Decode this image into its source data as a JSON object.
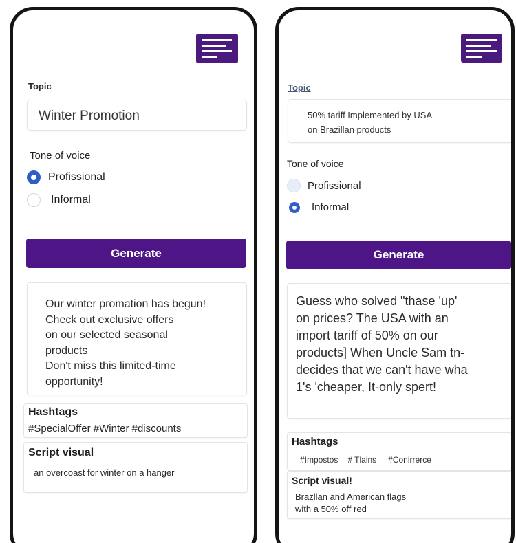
{
  "left": {
    "topic_label": "Topic",
    "topic_value": "Winter Promotion",
    "tone_label": "Tone of voice",
    "options": [
      {
        "label": "Profissional",
        "selected": true
      },
      {
        "label": "Informal",
        "selected": false
      }
    ],
    "generate_label": "Generate",
    "post_lines": [
      "Our winter promation has begun!",
      "Check out exclusive offers",
      "on our selected seasonal",
      "products",
      "Don't miss this limited-time",
      "opportunity!"
    ],
    "hashtags_title": "Hashtags",
    "hashtags": "#SpecialOffer #Winter #discounts",
    "script_title": "Script visual",
    "script_text": "an overcoast for winter on a hanger"
  },
  "right": {
    "topic_label": "Topic",
    "topic_lines": [
      "50% tariff Implemented   by USA",
      "on Brazillan products"
    ],
    "tone_label": "Tone of voice",
    "options": [
      {
        "label": "Profissional",
        "selected": false
      },
      {
        "label": "Informal",
        "selected": true
      }
    ],
    "generate_label": "Generate",
    "post_lines": [
      "Guess who solved \"thase 'up'",
      "on prices? The USA with an",
      "import tariff of 50% on our",
      "products] When Uncle Sam tn-",
      "decides that we can't have wha",
      "1's 'cheaper, It-only spert!"
    ],
    "hashtags_title": "Hashtags",
    "hashtags": [
      "#Impostos",
      "# Tlains",
      "#Conirrerce"
    ],
    "script_title": "Script visual!",
    "script_lines": [
      "Brazllan and  American flags",
      "with a 50% off red"
    ]
  },
  "colors": {
    "accent": "#4e1586",
    "radio_selected": "#2f5fc4",
    "frame": "#141414"
  }
}
